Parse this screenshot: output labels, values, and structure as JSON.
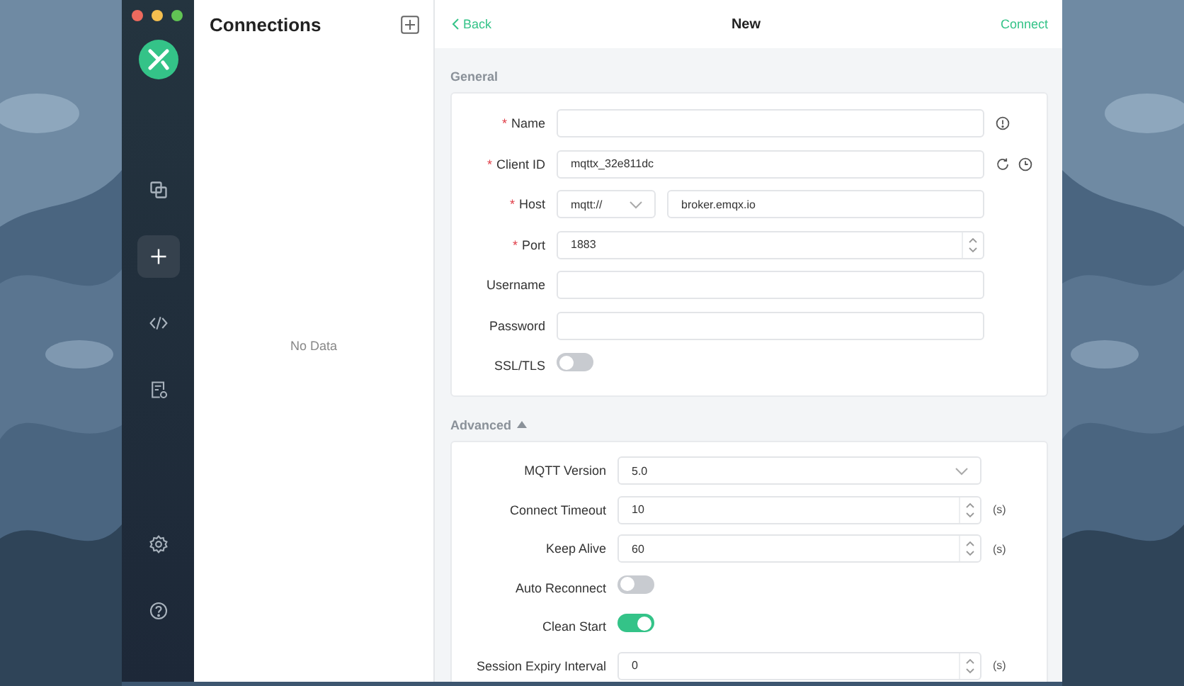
{
  "sidebar": {
    "nav": [
      {
        "kind": "connections",
        "selected": false
      },
      {
        "kind": "new",
        "selected": true
      },
      {
        "kind": "script",
        "selected": false
      },
      {
        "kind": "log",
        "selected": false
      }
    ],
    "bottom": [
      {
        "kind": "settings",
        "selected": false
      },
      {
        "kind": "help",
        "selected": false
      }
    ]
  },
  "connections": {
    "title": "Connections",
    "empty": "No Data"
  },
  "header": {
    "back": "Back",
    "title": "New",
    "action": "Connect"
  },
  "general": {
    "title": "General",
    "fields": [
      {
        "label": "Name",
        "marker": "*",
        "kind": "text-info"
      },
      {
        "label": "Client ID",
        "marker": "*",
        "kind": "text-generate",
        "value": "mqttx_32e811dc"
      },
      {
        "label": "Host",
        "marker": "*",
        "kind": "protocol-host",
        "protocol": "mqtt://",
        "value": "broker.emqx.io"
      },
      {
        "label": "Port",
        "marker": "*",
        "kind": "number",
        "value": "1883"
      },
      {
        "label": "Username",
        "kind": "text"
      },
      {
        "label": "Password",
        "kind": "text"
      },
      {
        "label": "SSL/TLS",
        "kind": "toggle",
        "on": false
      }
    ]
  },
  "advanced": {
    "title": "Advanced",
    "expanded": true,
    "fields": [
      {
        "label": "MQTT Version",
        "kind": "select",
        "value": "5.0"
      },
      {
        "label": "Connect Timeout",
        "kind": "number",
        "value": "10",
        "unit": "(s)"
      },
      {
        "label": "Keep Alive",
        "kind": "number",
        "value": "60",
        "unit": "(s)"
      },
      {
        "label": "Auto Reconnect",
        "kind": "toggle",
        "on": false
      },
      {
        "label": "Clean Start",
        "kind": "toggle",
        "on": true
      },
      {
        "label": "Session Expiry Interval",
        "kind": "number",
        "value": "0",
        "unit": "(s)"
      }
    ]
  }
}
